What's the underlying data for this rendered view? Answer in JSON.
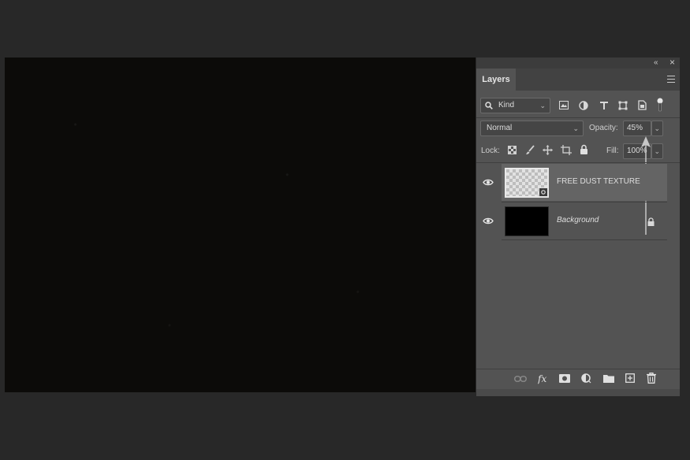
{
  "panel": {
    "collapse_icon": "«",
    "close_icon": "×",
    "tab_label": "Layers",
    "filter": {
      "value": "Kind"
    },
    "blend_mode": {
      "value": "Normal"
    },
    "opacity": {
      "label": "Opacity:",
      "value": "45%"
    },
    "lock_label": "Lock:",
    "fill": {
      "label": "Fill:",
      "value": "100%"
    },
    "layers": [
      {
        "name": "FREE DUST TEXTURE",
        "selected": true
      },
      {
        "name": "Background",
        "selected": false
      }
    ]
  },
  "colors": {
    "workspace": "#282828",
    "panel": "#535353",
    "selected_row": "#646464",
    "canvas": "#0c0b09"
  }
}
